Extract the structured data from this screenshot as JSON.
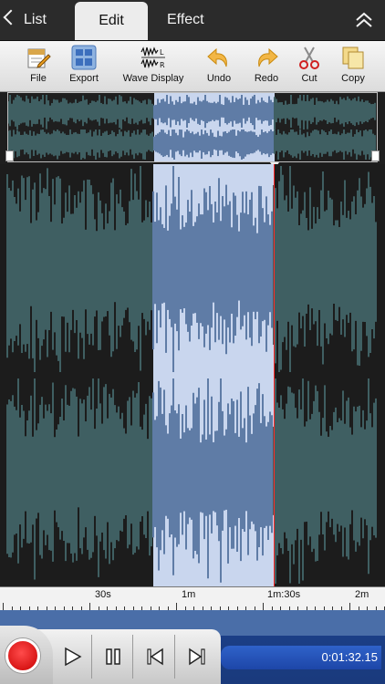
{
  "tabs": {
    "back_label": "List",
    "edit_label": "Edit",
    "effect_label": "Effect"
  },
  "toolbar": {
    "items": [
      {
        "label": "File",
        "icon": "file-icon"
      },
      {
        "label": "Export",
        "icon": "export-icon"
      },
      {
        "label": "Wave Display",
        "icon": "wave-display-icon"
      },
      {
        "label": "Undo",
        "icon": "undo-icon"
      },
      {
        "label": "Redo",
        "icon": "redo-icon"
      },
      {
        "label": "Cut",
        "icon": "scissors-icon"
      },
      {
        "label": "Copy",
        "icon": "copy-icon"
      }
    ]
  },
  "ruler": {
    "labels": [
      "30s",
      "1m",
      "1m:30s",
      "2m"
    ]
  },
  "transport": {
    "time": "0:01:32.15"
  },
  "colors": {
    "selection": "#c9d6ee",
    "wave_unselected": "#3f5f62",
    "wave_selected": "#5f7ca6",
    "cursor": "#ff2a2a",
    "time_display": "#2555bb"
  }
}
